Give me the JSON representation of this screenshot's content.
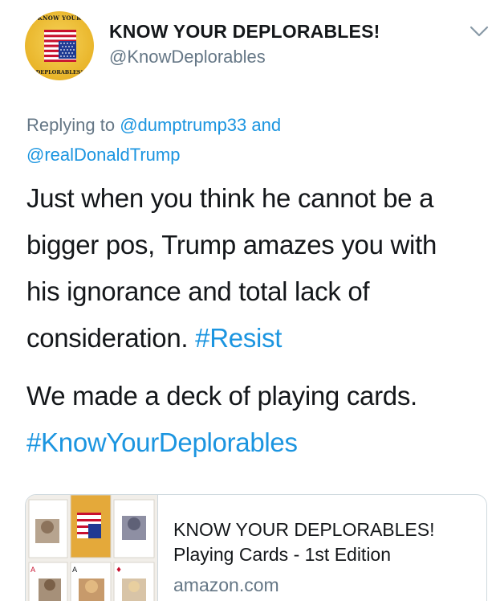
{
  "author": {
    "display_name": "KNOW YOUR DEPLORABLES!",
    "handle": "@KnowDeplorables",
    "avatar": {
      "top_text": "KNOW YOUR",
      "bottom_text": "DEPLORABLES!"
    }
  },
  "reply_context": {
    "prefix": "Replying to",
    "mention_1": "@dumptrump33",
    "conjunction": "and",
    "mention_2": "@realDonaldTrump"
  },
  "body": {
    "line_1": "Just when you think he cannot be a",
    "line_2": "bigger pos, Trump amazes you with",
    "line_3": "his ignorance and total lack of",
    "line_4_text": "consideration.",
    "line_4_hashtag": "#Resist",
    "line_5": "We made a deck of playing cards.",
    "line_6_hashtag": "#KnowYourDeplorables"
  },
  "link_card": {
    "title": "KNOW YOUR DEPLORABLES!",
    "subtitle": "Playing Cards - 1st Edition",
    "domain": "amazon.com"
  },
  "icons": {
    "caret": "chevron-down-icon"
  },
  "colors": {
    "link": "#1b95e0",
    "secondary_text": "#657786",
    "primary_text": "#14171a",
    "border": "#cfd9de",
    "avatar_gold": "#e9b52a"
  }
}
